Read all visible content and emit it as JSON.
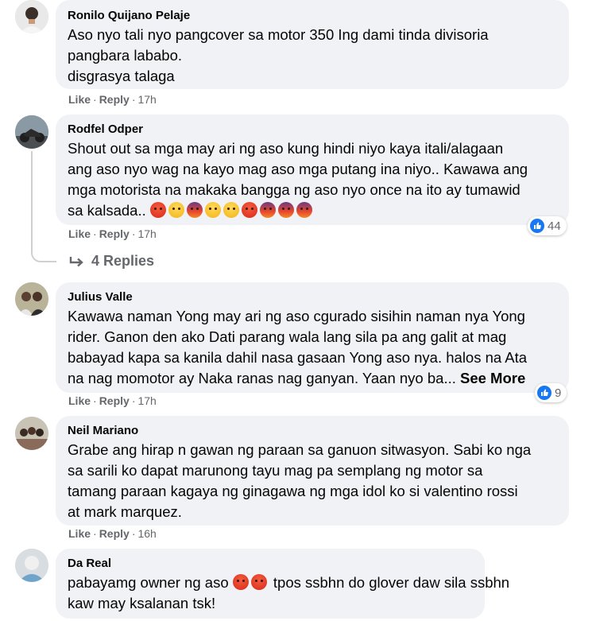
{
  "comments": [
    {
      "author": "Ronilo Quijano Pelaje",
      "lines": [
        "Aso nyo tali nyo pangcover sa motor 350 Ing dami tinda divisoria",
        "pangbara lababo.",
        "disgrasya talaga"
      ],
      "like": "Like",
      "reply": "Reply",
      "time": "17h"
    },
    {
      "author": "Rodfel Odper",
      "lines": [
        "Shout out sa mga may ari ng aso kung hindi niyo kaya itali/alagaan",
        "ang aso nyo wag na kayo mag aso mga putang ina niyo.. Kawawa ang",
        "mga motorista na makaka bangga ng aso nyo once na ito ay tumawid",
        "sa kalsada.."
      ],
      "emojis": [
        "angry",
        "sad",
        "scream",
        "sad",
        "sad",
        "angry",
        "scream",
        "scream",
        "scream"
      ],
      "like": "Like",
      "reply": "Reply",
      "time": "17h",
      "reaction_count": "44",
      "replies_label": "4 Replies"
    },
    {
      "author": "Julius Valle",
      "lines": [
        "Kawawa naman Yong may ari ng aso cgurado sisihin naman nya Yong",
        "rider. Ganon den ako Dati parang wala lang sila pa ang galit at mag",
        "babayad kapa sa kanila dahil nasa gasaan Yong aso nya. halos na Ata",
        "na nag momotor ay Naka ranas nag ganyan. Yaan nyo ba..."
      ],
      "see_more": "See More",
      "like": "Like",
      "reply": "Reply",
      "time": "17h",
      "reaction_count": "9"
    },
    {
      "author": "Neil Mariano",
      "lines": [
        "Grabe ang hirap n gawan ng paraan sa ganuon sitwasyon. Sabi ko nga",
        "sa sarili ko dapat marunong tayu mag pa semplang ng motor sa",
        "tamang paraan kagaya ng ginagawa ng mga idol ko si valentino rossi",
        "at mark marquez."
      ],
      "like": "Like",
      "reply": "Reply",
      "time": "16h"
    },
    {
      "author": "Da Real",
      "line1_before": "pabayamg owner ng aso",
      "line1_emojis": [
        "angry",
        "angry"
      ],
      "line1_after": "tpos ssbhn do glover daw sila ssbhn",
      "line2": "kaw may ksalanan tsk!"
    }
  ]
}
